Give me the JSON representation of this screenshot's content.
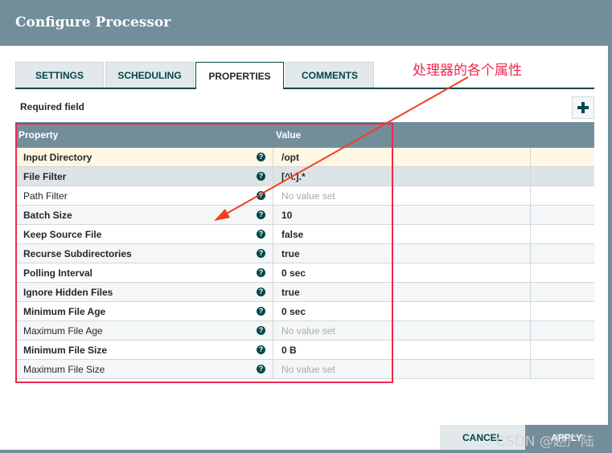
{
  "dialog": {
    "title": "Configure Processor"
  },
  "tabs": [
    {
      "label": "SETTINGS",
      "active": false
    },
    {
      "label": "SCHEDULING",
      "active": false
    },
    {
      "label": "PROPERTIES",
      "active": true
    },
    {
      "label": "COMMENTS",
      "active": false
    }
  ],
  "properties": {
    "required_label": "Required field",
    "add_icon": "plus-icon",
    "columns": {
      "property": "Property",
      "value": "Value"
    },
    "rows": [
      {
        "name": "Input Directory",
        "value": "/opt",
        "required": true,
        "unset": false
      },
      {
        "name": "File Filter",
        "value": "[^\\.].*",
        "required": true,
        "unset": false
      },
      {
        "name": "Path Filter",
        "value": "No value set",
        "required": false,
        "unset": true
      },
      {
        "name": "Batch Size",
        "value": "10",
        "required": true,
        "unset": false
      },
      {
        "name": "Keep Source File",
        "value": "false",
        "required": true,
        "unset": false
      },
      {
        "name": "Recurse Subdirectories",
        "value": "true",
        "required": true,
        "unset": false
      },
      {
        "name": "Polling Interval",
        "value": "0 sec",
        "required": true,
        "unset": false
      },
      {
        "name": "Ignore Hidden Files",
        "value": "true",
        "required": true,
        "unset": false
      },
      {
        "name": "Minimum File Age",
        "value": "0 sec",
        "required": true,
        "unset": false
      },
      {
        "name": "Maximum File Age",
        "value": "No value set",
        "required": false,
        "unset": true
      },
      {
        "name": "Minimum File Size",
        "value": "0 B",
        "required": true,
        "unset": false
      },
      {
        "name": "Maximum File Size",
        "value": "No value set",
        "required": false,
        "unset": true
      }
    ],
    "help_icon": "question-circle-icon"
  },
  "annotation": {
    "text": "处理器的各个属性",
    "color": "#f0264f",
    "arrow_color": "#f0401f"
  },
  "footer": {
    "cancel_label": "CANCEL",
    "apply_label": "APPLY"
  },
  "watermark": "CSDN @赵广陆",
  "colors": {
    "header": "#728e9b",
    "accent": "#004849",
    "selected_row": "#fff7e4"
  }
}
